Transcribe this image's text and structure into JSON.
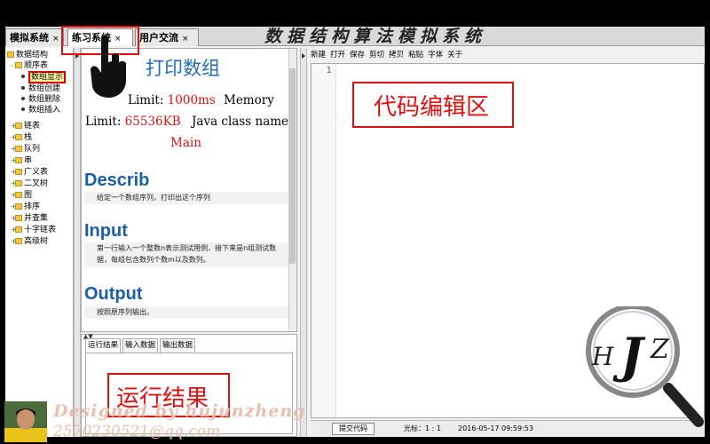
{
  "tabs": [
    {
      "label": "模拟系统",
      "close": "×"
    },
    {
      "label": "练习系统",
      "close": "×"
    },
    {
      "label": "用户交流",
      "close": "×"
    }
  ],
  "banner": "数据结构算法模拟系统",
  "tree": {
    "root": "数据结构",
    "sequence": "顺序表",
    "children": [
      "数组显示",
      "数组创建",
      "数组删除",
      "数组插入"
    ],
    "items": [
      "链表",
      "栈",
      "队列",
      "串",
      "广义表",
      "二叉树",
      "图",
      "排序",
      "并查集",
      "十字链表",
      "高级树"
    ]
  },
  "problem": {
    "title": "打印数组",
    "time_limit_label": "Limit:",
    "time_limit_value": "1000ms",
    "memory_label": "Memory",
    "memory_limit_label": "Limit:",
    "memory_limit_value": "65536KB",
    "class_label": "Java class name:",
    "class_value": "Main",
    "describe_heading": "Describ",
    "describe_text": "给定一个数组序列，打印出这个序列",
    "input_heading": "Input",
    "input_text_1": "第一行输入一个整数n表示测试用例，接下来是n组测试数",
    "input_text_2": "据，每组包含数列个数m以及数列。",
    "output_heading": "Output",
    "output_text": "按照原序列输出。"
  },
  "result_tabs": [
    "运行结果",
    "输入数据",
    "输出数据"
  ],
  "editor": {
    "menu": [
      "新建",
      "打开",
      "保存",
      "剪切",
      "拷贝",
      "粘贴",
      "字体",
      "关于"
    ],
    "line_number": "1",
    "submit_label": "提交代码",
    "cursor_label": "光标：1 : 1",
    "timestamp": "2016-05-17 09:59:53"
  },
  "annotations": {
    "editor_area": "代码编辑区",
    "result_area": "运行结果"
  },
  "logo": {
    "letters": [
      "H",
      "J",
      "Z"
    ]
  },
  "credit": {
    "line1": "Designed by hujunzheng",
    "line2": "2570230521@qq.com"
  },
  "colors": {
    "accent": "#1a5ea8",
    "highlight": "#e01010",
    "limit_red": "#d11111"
  }
}
